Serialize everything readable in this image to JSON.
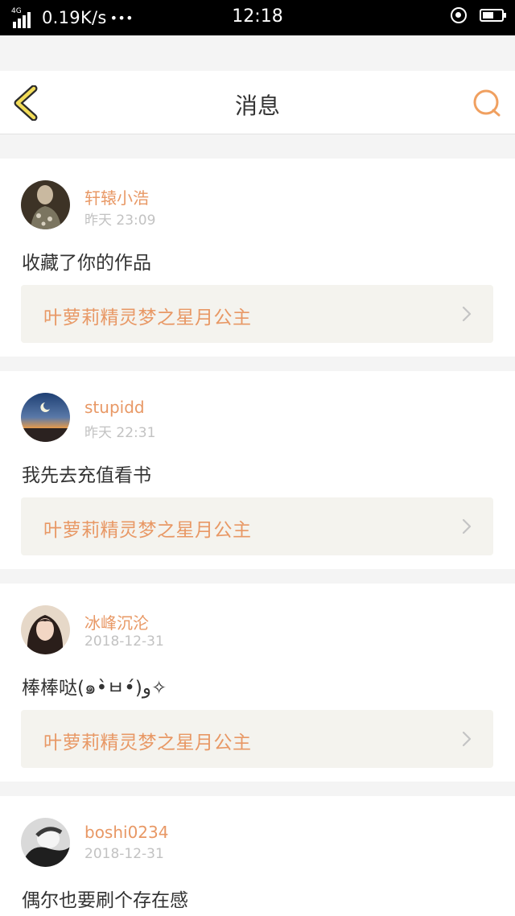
{
  "status_bar": {
    "network": "4G",
    "speed": "0.19K/s",
    "dots": "•••",
    "time": "12:18",
    "battery_level": 0.6,
    "signal_icon": "signal-bars-icon",
    "location_icon": "location-icon",
    "battery_icon": "battery-icon"
  },
  "header": {
    "title": "消息",
    "back_icon": "back-chevron-icon",
    "search_icon": "search-icon",
    "accent_color": "#f0a060"
  },
  "messages": [
    {
      "username": "轩辕小浩",
      "time": "昨天 23:09",
      "text": "收藏了你的作品",
      "work_title": "叶萝莉精灵梦之星月公主"
    },
    {
      "username": "stupidd",
      "time": "昨天 22:31",
      "text": "我先去充值看书",
      "work_title": "叶萝莉精灵梦之星月公主"
    },
    {
      "username": "冰峰沉沦",
      "time": "2018-12-31",
      "text": "棒棒哒(๑•̀ㅂ•́)و✧",
      "work_title": "叶萝莉精灵梦之星月公主"
    },
    {
      "username": "boshi0234",
      "time": "2018-12-31",
      "text": "偶尔也要刷个存在感"
    }
  ],
  "colors": {
    "username": "#e89865",
    "link_background": "#f4f3ee",
    "timestamp": "#c2c2c2"
  }
}
